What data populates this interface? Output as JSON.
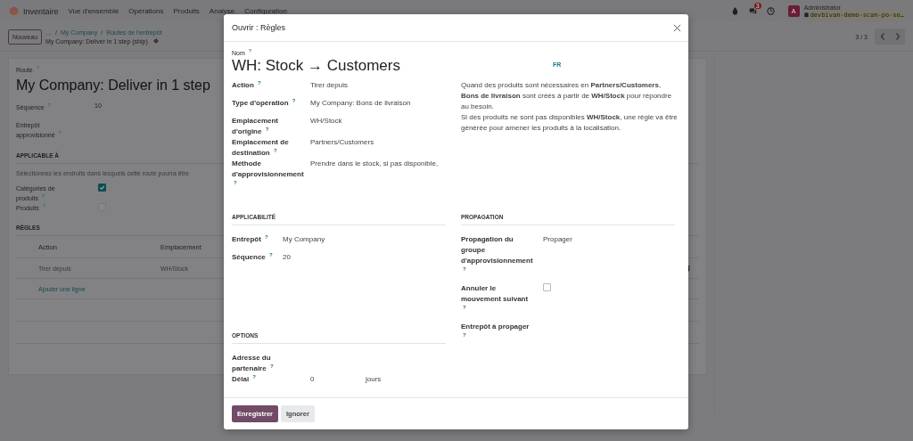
{
  "navbar": {
    "app": "Inventaire",
    "menu": [
      "Vue d'ensemble",
      "Opérations",
      "Produits",
      "Analyse",
      "Configuration"
    ],
    "chat_badge": "3",
    "user": {
      "initial": "A",
      "name": "Administrator",
      "database": "devbivan-demo-scan-po-so…"
    }
  },
  "control_panel": {
    "new_button": "Nouveau",
    "breadcrumbs": [
      "…",
      "My Company",
      "Routes de l'entrepôt"
    ],
    "breadcrumb_separator": "/",
    "record": "My Company: Deliver in 1 step (ship)",
    "pager": "3 / 3"
  },
  "route_form": {
    "route_label": "Route $^{?}$",
    "route_title": "My Company: Deliver in 1 step",
    "fields": [
      {
        "label": "Séquence $^{?}$",
        "value": "10"
      },
      {
        "label": "Entrepôt approvisionné $^{?}$"
      }
    ],
    "applicable_heading": "APPLICABLE À",
    "applicable_hint": "Sélectionnez les endroits dans lesquels cette route pourra être",
    "checkboxes": [
      {
        "label": "Catégories de produits $^{?}$",
        "checked": true
      },
      {
        "label": "Produits $^{?}$",
        "checked": false
      }
    ],
    "rules_heading": "RÈGLES",
    "table": {
      "columns": [
        "Action",
        "Emplacement"
      ],
      "rows": [
        [
          "Tirer depuis",
          "WH/Stock"
        ]
      ]
    },
    "add_line": "Ajouter une ligne"
  },
  "dialog": {
    "title": "Ouvrir : Règles",
    "name_label": "Nom $^{?}$",
    "name": "WH: Stock → Customers",
    "lang": "FR",
    "fields": [
      {
        "label": "Action $^{?}$",
        "value": "Tirer depuis"
      },
      {
        "label": "Type d'opération $^{?}$",
        "value": "My Company: Bons de livraison"
      },
      {
        "label": "Emplacement d'origine $^{?}$",
        "value": "WH/Stock"
      },
      {
        "label": "Emplacement de destination $^{?}$",
        "value": "Partners/Customers"
      },
      {
        "label": "Méthode d'approvisionnement $^{?}$",
        "value": "Prendre dans le stock, si pas disponible,"
      }
    ],
    "description": [
      "Quand des produits sont nécessaires en **Partners/Customers**, **Bons de livraison** sont créés à partir de **WH/Stock** pour répondre au besoin.",
      "Si des produits ne sont pas disponibles **WH/Stock**, une règle va être générée pour amener les produits à la localisation."
    ],
    "applicability": {
      "heading": "APPLICABILITÉ",
      "fields": [
        {
          "label": "Entrepôt $^{?}$",
          "value": "My Company"
        },
        {
          "label": "Séquence $^{?}$",
          "value": "20"
        }
      ]
    },
    "propagation": {
      "heading": "PROPAGATION",
      "fields": [
        {
          "kind": "text",
          "label": "Propagation du groupe d'approvisionnement $^{?}$",
          "value": "Propager"
        },
        {
          "kind": "checkbox",
          "label": "Annuler le mouvement suivant $^{?}$",
          "checked": false
        },
        {
          "kind": "empty",
          "label": "Entrepôt à propager $^{?}$"
        }
      ]
    },
    "options": {
      "heading": "OPTIONS",
      "fields": [
        {
          "label": "Adresse du partenaire $^{?}$"
        },
        {
          "label": "Délai $^{?}$",
          "value": "0",
          "unit": "jours"
        }
      ]
    },
    "buttons": [
      {
        "label": "Enregistrer",
        "primary": true
      },
      {
        "label": "Ignorer",
        "primary": false
      }
    ]
  }
}
